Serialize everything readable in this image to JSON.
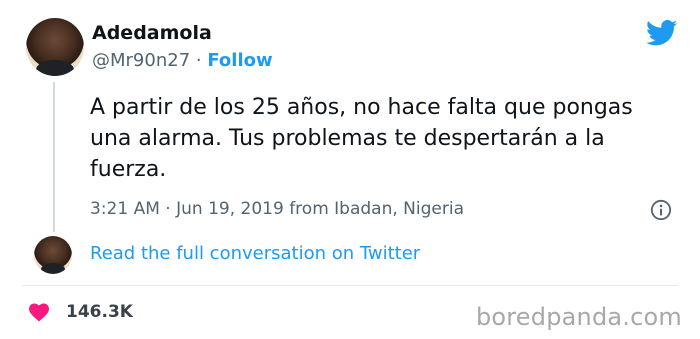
{
  "author": {
    "display_name": "Adedamola",
    "handle": "@Mr90n27",
    "separator": "·",
    "follow_label": "Follow"
  },
  "tweet": {
    "text": "A partir de los 25 años, no hace falta que pongas una alarma. Tus problemas te despertarán a la fuerza.",
    "time": "3:21 AM",
    "separator": "·",
    "date": "Jun 19, 2019",
    "location": "from Ibadan, Nigeria"
  },
  "thread": {
    "link_text": "Read the full conversation on Twitter"
  },
  "engagement": {
    "likes": "146.3K"
  },
  "watermark": "boredpanda.com",
  "icons": {
    "brand": "twitter-bird-icon",
    "info": "info-icon",
    "like": "heart-icon"
  },
  "colors": {
    "accent": "#1d9bf0",
    "heart": "#f91880",
    "secondary_text": "#536471",
    "primary_text": "#0f1419"
  }
}
